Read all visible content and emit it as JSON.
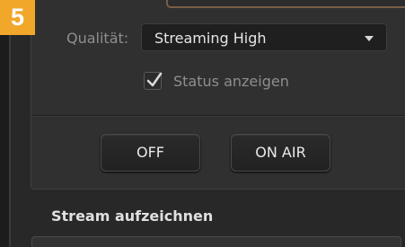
{
  "badge": {
    "step": "5"
  },
  "stream": {
    "quality_label": "Qualität:",
    "quality_value": "Streaming High",
    "status_label": "Status anzeigen",
    "status_checked": true
  },
  "buttons": {
    "off_label": "OFF",
    "onair_label": "ON AIR"
  },
  "record": {
    "title": "Stream aufzeichnen"
  },
  "colors": {
    "badge": "#f0a72a",
    "background": "#282828",
    "panel": "#303030"
  },
  "icons": {
    "dropdown": "chevron-down-icon",
    "check": "checkmark-icon"
  }
}
